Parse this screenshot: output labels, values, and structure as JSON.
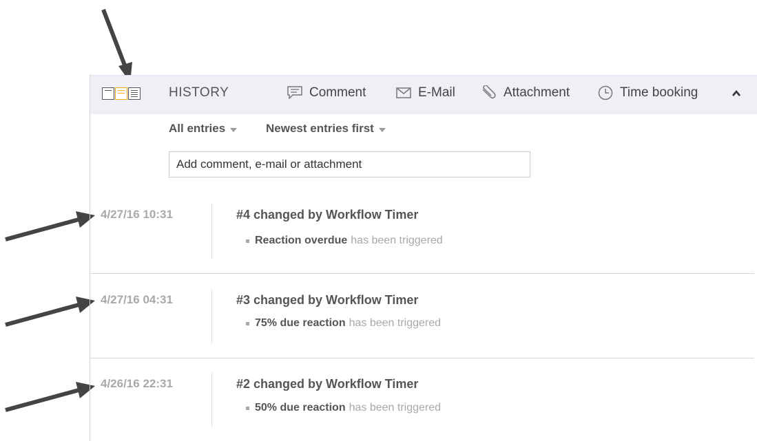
{
  "view_modes": [
    "compact",
    "standard",
    "detailed"
  ],
  "view_modes_active": "standard",
  "header": {
    "title": "HISTORY",
    "comment_label": "Comment",
    "email_label": "E-Mail",
    "attachment_label": "Attachment",
    "time_booking_label": "Time booking",
    "collapse_icon": "chevron-up-icon"
  },
  "filters": {
    "entries": "All entries",
    "order": "Newest entries first"
  },
  "comment_box": {
    "placeholder": "Add comment, e-mail or attachment",
    "value": ""
  },
  "entries": [
    {
      "time": "4/27/16 10:31",
      "title": "#4 changed by Workflow Timer",
      "detail_strong": "Reaction overdue",
      "detail_rest": "has been triggered"
    },
    {
      "time": "4/27/16 04:31",
      "title": "#3 changed by Workflow Timer",
      "detail_strong": "75% due reaction",
      "detail_rest": "has been triggered"
    },
    {
      "time": "4/26/16 22:31",
      "title": "#2 changed by Workflow Timer",
      "detail_strong": "50% due reaction",
      "detail_rest": "has been triggered"
    }
  ],
  "colors": {
    "header_bg": "#eef0f6",
    "active_view": "#f5a623",
    "arrow": "#444444",
    "muted_text": "#a9a9a9"
  }
}
